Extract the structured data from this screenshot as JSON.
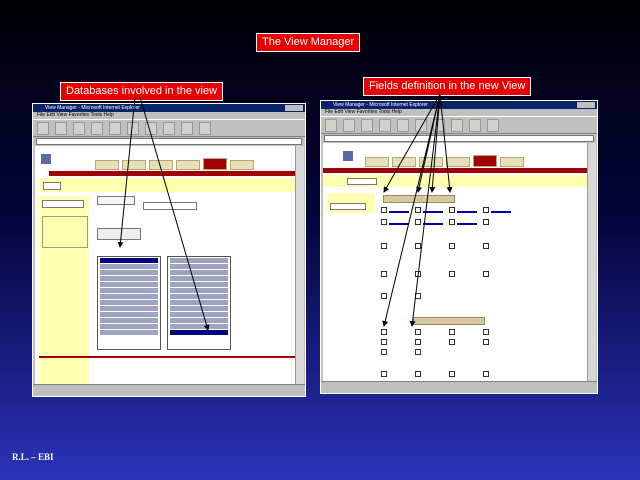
{
  "slide": {
    "title": "The View Manager",
    "left_caption": "Databases involved in the view",
    "right_caption": "Fields definition in the new View",
    "footer": "R.L.  – EBI"
  },
  "windows": [
    {
      "id": "left",
      "title": "View Manager - Microsoft Internet Explorer"
    },
    {
      "id": "right",
      "title": "View Manager - Microsoft Internet Explorer"
    }
  ],
  "colors": {
    "label_bg": "#e60000",
    "titlebar": "#0a246a",
    "tab_active": "#a00000",
    "panel_yellow": "#ffffb0"
  }
}
